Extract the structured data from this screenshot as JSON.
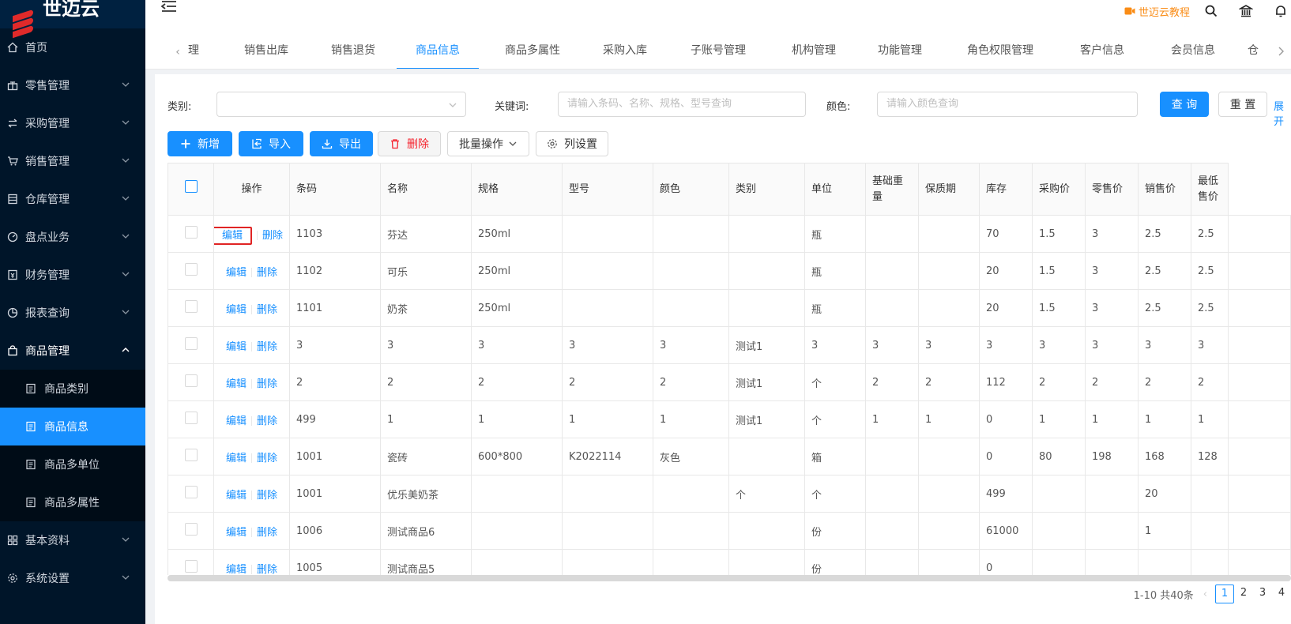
{
  "app": {
    "logo_text": "世迈云"
  },
  "sidebar": {
    "items": [
      {
        "label": "首页"
      },
      {
        "label": "零售管理"
      },
      {
        "label": "采购管理"
      },
      {
        "label": "销售管理"
      },
      {
        "label": "仓库管理"
      },
      {
        "label": "盘点业务"
      },
      {
        "label": "财务管理"
      },
      {
        "label": "报表查询"
      },
      {
        "label": "商品管理"
      },
      {
        "label": "基本资料"
      },
      {
        "label": "系统设置"
      }
    ],
    "submenu": [
      {
        "label": "商品类别"
      },
      {
        "label": "商品信息"
      },
      {
        "label": "商品多单位"
      },
      {
        "label": "商品多属性"
      }
    ]
  },
  "header": {
    "tutorial_label": "世迈云教程"
  },
  "tabs": [
    {
      "label": "理"
    },
    {
      "label": "销售出库"
    },
    {
      "label": "销售退货"
    },
    {
      "label": "商品信息"
    },
    {
      "label": "商品多属性"
    },
    {
      "label": "采购入库"
    },
    {
      "label": "子账号管理"
    },
    {
      "label": "机构管理"
    },
    {
      "label": "功能管理"
    },
    {
      "label": "角色权限管理"
    },
    {
      "label": "客户信息"
    },
    {
      "label": "会员信息"
    },
    {
      "label": "仓"
    }
  ],
  "search": {
    "category_label": "类别:",
    "keyword_label": "关键词:",
    "keyword_placeholder": "请输入条码、名称、规格、型号查询",
    "color_label": "颜色:",
    "color_placeholder": "请输入颜色查询",
    "query_button": "查 询",
    "reset_button": "重 置",
    "expand_link": "展开"
  },
  "toolbar": {
    "add": "新增",
    "import": "导入",
    "export": "导出",
    "delete": "删除",
    "batch": "批量操作",
    "columns": "列设置"
  },
  "table": {
    "columns": [
      "操作",
      "条码",
      "名称",
      "规格",
      "型号",
      "颜色",
      "类别",
      "单位",
      "基础重量",
      "保质期",
      "库存",
      "采购价",
      "零售价",
      "销售价",
      "最低售价"
    ],
    "edit_label": "编辑",
    "delete_label": "删除",
    "rows": [
      [
        "1103",
        "芬达",
        "250ml",
        "",
        "",
        "",
        "瓶",
        "",
        "",
        "70",
        "1.5",
        "3",
        "2.5",
        "2.5"
      ],
      [
        "1102",
        "可乐",
        "250ml",
        "",
        "",
        "",
        "瓶",
        "",
        "",
        "20",
        "1.5",
        "3",
        "2.5",
        "2.5"
      ],
      [
        "1101",
        "奶茶",
        "250ml",
        "",
        "",
        "",
        "瓶",
        "",
        "",
        "20",
        "1.5",
        "3",
        "2.5",
        "2.5"
      ],
      [
        "3",
        "3",
        "3",
        "3",
        "3",
        "测试1",
        "3",
        "3",
        "3",
        "3",
        "3",
        "3",
        "3",
        "3"
      ],
      [
        "2",
        "2",
        "2",
        "2",
        "2",
        "测试1",
        "个",
        "2",
        "2",
        "112",
        "2",
        "2",
        "2",
        "2"
      ],
      [
        "499",
        "1",
        "1",
        "1",
        "1",
        "测试1",
        "个",
        "1",
        "1",
        "0",
        "1",
        "1",
        "1",
        "1"
      ],
      [
        "1001",
        "瓷砖",
        "600*800",
        "K2022114",
        "灰色",
        "",
        "箱",
        "",
        "",
        "0",
        "80",
        "198",
        "168",
        "128"
      ],
      [
        "1001",
        "优乐美奶茶",
        "",
        "",
        "",
        "个",
        "个",
        "",
        "",
        "499",
        "",
        "",
        "20",
        ""
      ],
      [
        "1006",
        "测试商品6",
        "",
        "",
        "",
        "",
        "份",
        "",
        "",
        "61000",
        "",
        "",
        "1",
        ""
      ],
      [
        "1005",
        "测试商品5",
        "",
        "",
        "",
        "",
        "份",
        "",
        "",
        "0",
        "",
        "",
        "",
        ""
      ]
    ]
  },
  "pagination": {
    "total_text": "1-10 共40条",
    "pages": [
      "1",
      "2",
      "3",
      "4"
    ],
    "current": "1"
  }
}
